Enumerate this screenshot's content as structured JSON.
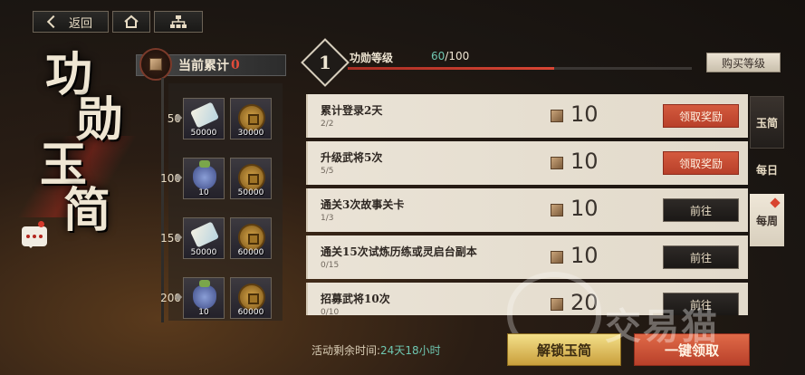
{
  "nav": {
    "back_label": "返回",
    "home_icon": "home-icon",
    "tree_icon": "hierarchy-icon"
  },
  "title": {
    "chars": [
      "功",
      "勋",
      "玉",
      "简"
    ]
  },
  "current_total": {
    "label": "当前累计",
    "value": "0"
  },
  "tiers": [
    {
      "level": "50",
      "items": [
        {
          "icon": "scroll-icon",
          "qty": "50000"
        },
        {
          "icon": "coin-icon",
          "qty": "30000"
        }
      ]
    },
    {
      "level": "100",
      "items": [
        {
          "icon": "bag-icon",
          "qty": "10"
        },
        {
          "icon": "coin-icon",
          "qty": "50000"
        }
      ]
    },
    {
      "level": "150",
      "items": [
        {
          "icon": "scroll-icon",
          "qty": "50000"
        },
        {
          "icon": "coin-icon",
          "qty": "60000"
        }
      ]
    },
    {
      "level": "200",
      "items": [
        {
          "icon": "bag-icon",
          "qty": "10"
        },
        {
          "icon": "coin-icon",
          "qty": "60000"
        }
      ]
    }
  ],
  "level": {
    "num": "1",
    "label": "功勋等级",
    "current": "60",
    "max": "/100",
    "progress": 0.6,
    "buy_label": "购买等级"
  },
  "tasks": [
    {
      "title": "累计登录2天",
      "progress": "2/2",
      "reward": "10",
      "button": "领取奖励",
      "state": "claim"
    },
    {
      "title": "升级武将5次",
      "progress": "5/5",
      "reward": "10",
      "button": "领取奖励",
      "state": "claim"
    },
    {
      "title": "通关3次故事关卡",
      "progress": "1/3",
      "reward": "10",
      "button": "前往",
      "state": "go"
    },
    {
      "title": "通关15次试炼历练或灵启台副本",
      "progress": "0/15",
      "reward": "10",
      "button": "前往",
      "state": "go"
    },
    {
      "title": "招募武将10次",
      "progress": "0/10",
      "reward": "20",
      "button": "前往",
      "state": "go"
    }
  ],
  "tabs": [
    {
      "label": "玉简"
    },
    {
      "label": "每日"
    },
    {
      "label": "每周"
    }
  ],
  "footer": {
    "timer_label": "活动剩余时间:",
    "timer_value": "24天18小时",
    "unlock_label": "解锁玉简",
    "claim_all_label": "一键领取"
  },
  "watermark": {
    "text": "交易猫"
  },
  "colors": {
    "accent_red": "#c0462e",
    "accent_teal": "#6ec6b0",
    "gold": "#d9b450"
  }
}
